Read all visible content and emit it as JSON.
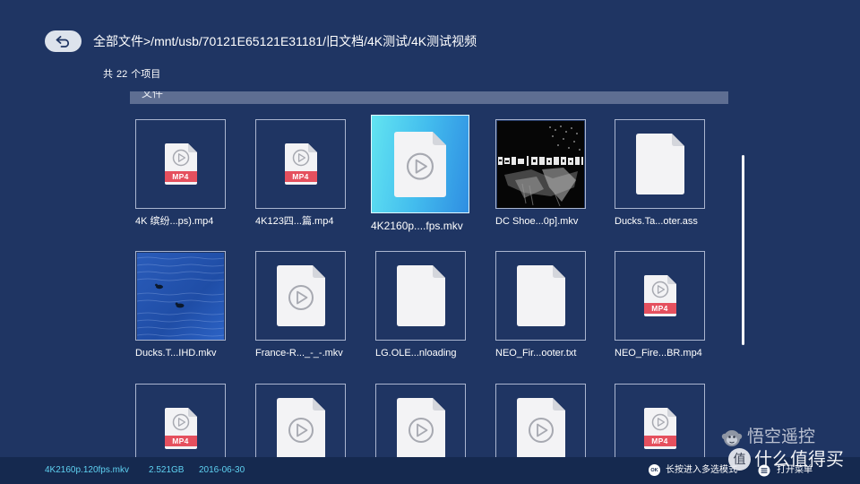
{
  "header": {
    "back_icon": "back-arrow-icon",
    "path": "全部文件>/mnt/usb/70121E65121E31181/旧文档/4K测试/4K测试视频",
    "count_prefix": "共",
    "count": "22",
    "count_suffix": "个项目"
  },
  "section": {
    "title": "文件"
  },
  "badge_label": "MP4",
  "files": [
    {
      "name": "4K 缤纷...ps).mp4",
      "icon": "mp4-file-icon"
    },
    {
      "name": "4K123四...篇.mp4",
      "icon": "mp4-file-icon"
    },
    {
      "name": "4K2160p....fps.mkv",
      "icon": "video-file-icon",
      "selected": true
    },
    {
      "name": "DC Shoe...0p].mkv",
      "icon": "video-thumbnail"
    },
    {
      "name": "Ducks.Ta...oter.ass",
      "icon": "document-file-icon"
    },
    {
      "name": "Ducks.T...IHD.mkv",
      "icon": "video-thumbnail"
    },
    {
      "name": "France-R..._-_-.mkv",
      "icon": "video-file-icon"
    },
    {
      "name": "LG.OLE...nloading",
      "icon": "document-file-icon"
    },
    {
      "name": "NEO_Fir...ooter.txt",
      "icon": "document-file-icon"
    },
    {
      "name": "NEO_Fire...BR.mp4",
      "icon": "mp4-file-icon"
    },
    {
      "icon": "mp4-file-icon"
    },
    {
      "icon": "video-file-icon"
    },
    {
      "icon": "video-file-icon"
    },
    {
      "icon": "video-file-icon"
    },
    {
      "icon": "mp4-file-icon"
    }
  ],
  "status_bar": {
    "filename": "4K2160p.120fps.mkv",
    "size": "2.521GB",
    "date": "2016-06-30",
    "ok_key": "OK",
    "ok_hint": "长按进入多选模式",
    "menu_icon": "menu-icon",
    "menu_hint": "打开菜单"
  },
  "watermarks": {
    "logo1_icon": "monkey-logo-icon",
    "logo1_text": "悟空遥控",
    "logo2_mark": "值",
    "logo2_text": "什么值得买"
  },
  "colors": {
    "background": "#1f3563",
    "status_bar": "#15294f",
    "selection_start": "#62e4f1",
    "selection_end": "#2f8ee2",
    "status_text": "#5fd2f2",
    "mp4_badge": "#e5505e"
  }
}
